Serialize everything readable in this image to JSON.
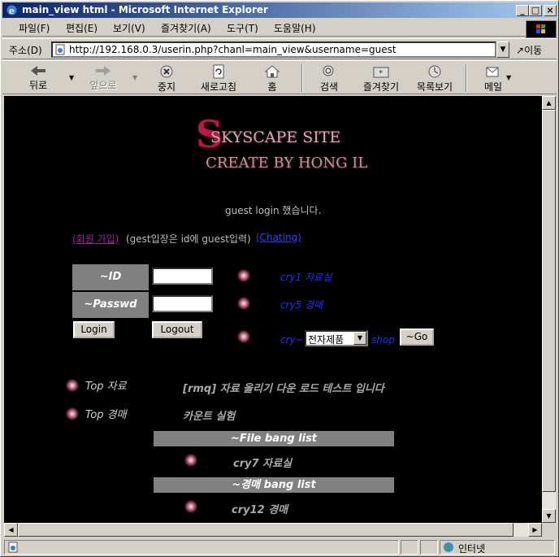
{
  "window": {
    "title": "main_view html - Microsoft Internet Explorer"
  },
  "menu": [
    "파일(F)",
    "편집(E)",
    "보기(V)",
    "즐겨찾기(A)",
    "도구(T)",
    "도움말(H)"
  ],
  "address": {
    "label": "주소(D)",
    "url": "http://192.168.0.3/userin.php?chanl=main_view&username=guest",
    "go_label": "이동"
  },
  "toolbar": {
    "back": "뒤로",
    "forward": "앞으로",
    "stop": "중지",
    "refresh": "새로고침",
    "home": "홈",
    "search": "검색",
    "favorites": "즐겨찾기",
    "history": "목록보기",
    "mail": "메일"
  },
  "page": {
    "logo_line1": "SKYSCAPE SITE",
    "logo_line2": "CREATE BY HONG IL",
    "login_message": "guest login 했습니다.",
    "signup_link": "(회원 가입)",
    "guest_note": "(gest입장은 id에 guest입력)",
    "chatting_link": "(Chating)",
    "id_label": "~ID",
    "passwd_label": "~Passwd",
    "login_button": "Login",
    "logout_button": "Logout",
    "cry1_link": "cry1 자료실",
    "cry5_link": "cry5 경매",
    "cry_prefix": "cry~",
    "category_selected": "전자제품",
    "shop_link": "shop",
    "go_button": "~Go",
    "top_data_label": "Top 자료",
    "top_auction_label": "Top 경매",
    "top_data_text": "[rmq] 자료 올리기 다운 로드 테스트 입니다",
    "top_auction_text": "카운트 실험",
    "file_bang_header": "~File bang list",
    "file_bang_item": "cry7 자료실",
    "auction_bang_header": "~경매 bang list",
    "auction_bang_item": "cry12 경매"
  },
  "status": {
    "zone": "인터넷"
  },
  "colors": {
    "title_bar": "#0a246a",
    "link_blue": "#2a2aff",
    "signup_purple": "#a020a0",
    "panel_gray": "#808080"
  }
}
